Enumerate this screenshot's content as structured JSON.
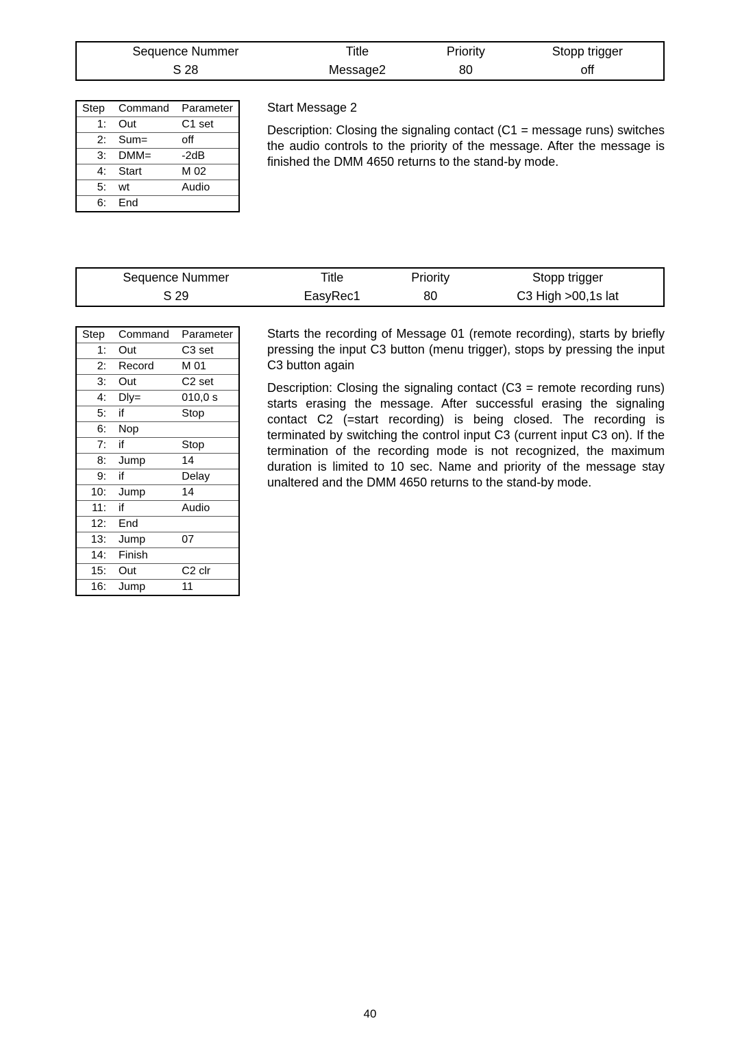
{
  "seq1": {
    "headers": {
      "col1": "Sequence Nummer",
      "col2": "Title",
      "col3": "Priority",
      "col4": "Stopp trigger"
    },
    "values": {
      "col1": "S 28",
      "col2": "Message2",
      "col3": "80",
      "col4": "off"
    }
  },
  "steps1": {
    "headers": {
      "step": "Step",
      "cmd": "Command",
      "param": "Parameter"
    },
    "rows": [
      {
        "step": "1:",
        "cmd": "Out",
        "param": "C1 set"
      },
      {
        "step": "2:",
        "cmd": "Sum=",
        "param": "off"
      },
      {
        "step": "3:",
        "cmd": "DMM=",
        "param": "-2dB"
      },
      {
        "step": "4:",
        "cmd": "Start",
        "param": "M 02"
      },
      {
        "step": "5:",
        "cmd": "wt",
        "param": "Audio"
      },
      {
        "step": "6:",
        "cmd": "End",
        "param": ""
      }
    ]
  },
  "text1": {
    "title": "Start Message 2",
    "desc": "Description: Closing the signaling contact (C1 = message runs) switches the audio controls to the priority of the message. After the message is finished the DMM 4650 returns to the stand-by mode."
  },
  "seq2": {
    "headers": {
      "col1": "Sequence Nummer",
      "col2": "Title",
      "col3": "Priority",
      "col4": "Stopp trigger"
    },
    "values": {
      "col1": "S 29",
      "col2": "EasyRec1",
      "col3": "80",
      "col4": "C3 High >00,1s lat"
    }
  },
  "steps2": {
    "headers": {
      "step": "Step",
      "cmd": "Command",
      "param": "Parameter"
    },
    "rows": [
      {
        "step": "1:",
        "cmd": "Out",
        "param": "C3 set"
      },
      {
        "step": "2:",
        "cmd": "Record",
        "param": "M 01"
      },
      {
        "step": "3:",
        "cmd": "Out",
        "param": "C2 set"
      },
      {
        "step": "4:",
        "cmd": "Dly=",
        "param": "010,0 s"
      },
      {
        "step": "5:",
        "cmd": "if",
        "param": "Stop"
      },
      {
        "step": "6:",
        "cmd": "Nop",
        "param": ""
      },
      {
        "step": "7:",
        "cmd": "if",
        "param": "Stop"
      },
      {
        "step": "8:",
        "cmd": "Jump",
        "param": "14"
      },
      {
        "step": "9:",
        "cmd": "if",
        "param": "Delay"
      },
      {
        "step": "10:",
        "cmd": "Jump",
        "param": "14"
      },
      {
        "step": "11:",
        "cmd": "if",
        "param": "Audio"
      },
      {
        "step": "12:",
        "cmd": "End",
        "param": ""
      },
      {
        "step": "13:",
        "cmd": "Jump",
        "param": "07"
      },
      {
        "step": "14:",
        "cmd": "Finish",
        "param": ""
      },
      {
        "step": "15:",
        "cmd": "Out",
        "param": "C2 clr"
      },
      {
        "step": "16:",
        "cmd": "Jump",
        "param": "11"
      }
    ]
  },
  "text2": {
    "p1": "Starts the recording of Message 01 (remote recording), starts by briefly pressing the input C3 button (menu trigger), stops by pressing the input C3 button again",
    "p2": "Description: Closing the signaling contact (C3 = remote recording runs) starts erasing the message. After successful erasing the signaling contact C2 (=start recording) is being closed. The recording is terminated by switching the control input C3 (current input C3 on). If the termination of the recording mode is not recognized, the maximum duration is limited to 10 sec. Name and priority of the message stay unaltered and the DMM 4650 returns to the stand-by mode."
  },
  "page_number": "40"
}
